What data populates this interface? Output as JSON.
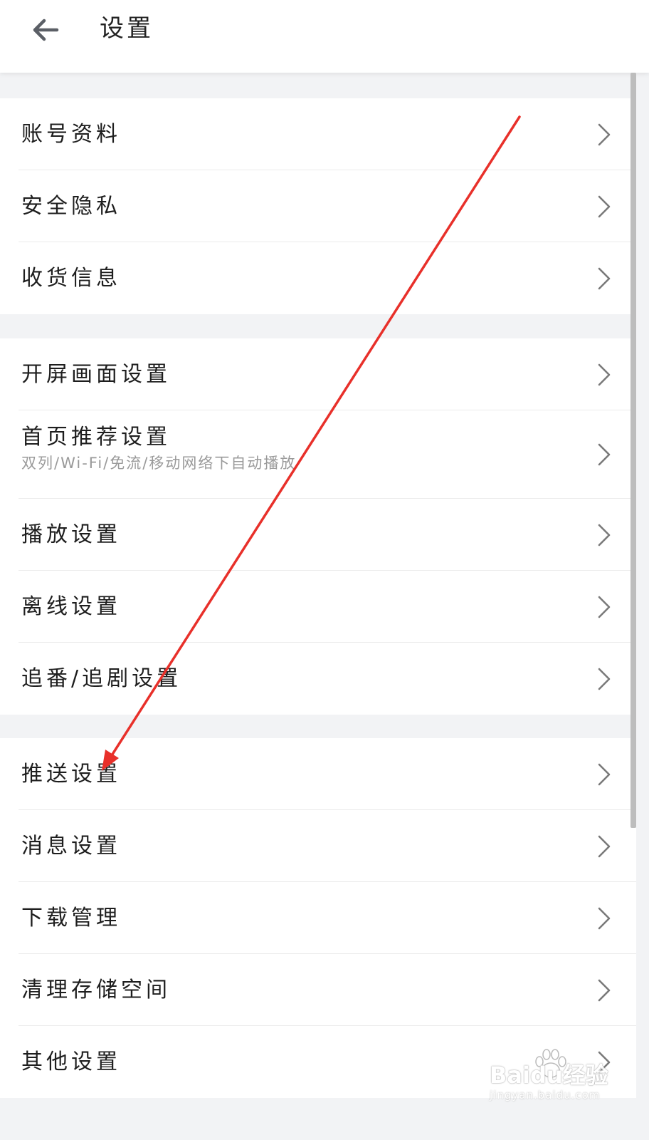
{
  "header": {
    "title": "设置"
  },
  "groups": [
    {
      "items": [
        {
          "label": "账号资料"
        },
        {
          "label": "安全隐私"
        },
        {
          "label": "收货信息"
        }
      ]
    },
    {
      "items": [
        {
          "label": "开屏画面设置"
        },
        {
          "label": "首页推荐设置",
          "subtitle": "双列/Wi-Fi/免流/移动网络下自动播放"
        },
        {
          "label": "播放设置"
        },
        {
          "label": "离线设置"
        },
        {
          "label": "追番/追剧设置"
        }
      ]
    },
    {
      "items": [
        {
          "label": "推送设置"
        },
        {
          "label": "消息设置"
        },
        {
          "label": "下载管理"
        },
        {
          "label": "清理存储空间"
        },
        {
          "label": "其他设置"
        }
      ]
    }
  ],
  "watermark": {
    "brand": "Baidu经验",
    "url": "jingyan.baidu.com"
  },
  "colors": {
    "annotation_arrow": "#e8302a",
    "background": "#f2f3f5",
    "subtitle": "#9a9a9a"
  }
}
